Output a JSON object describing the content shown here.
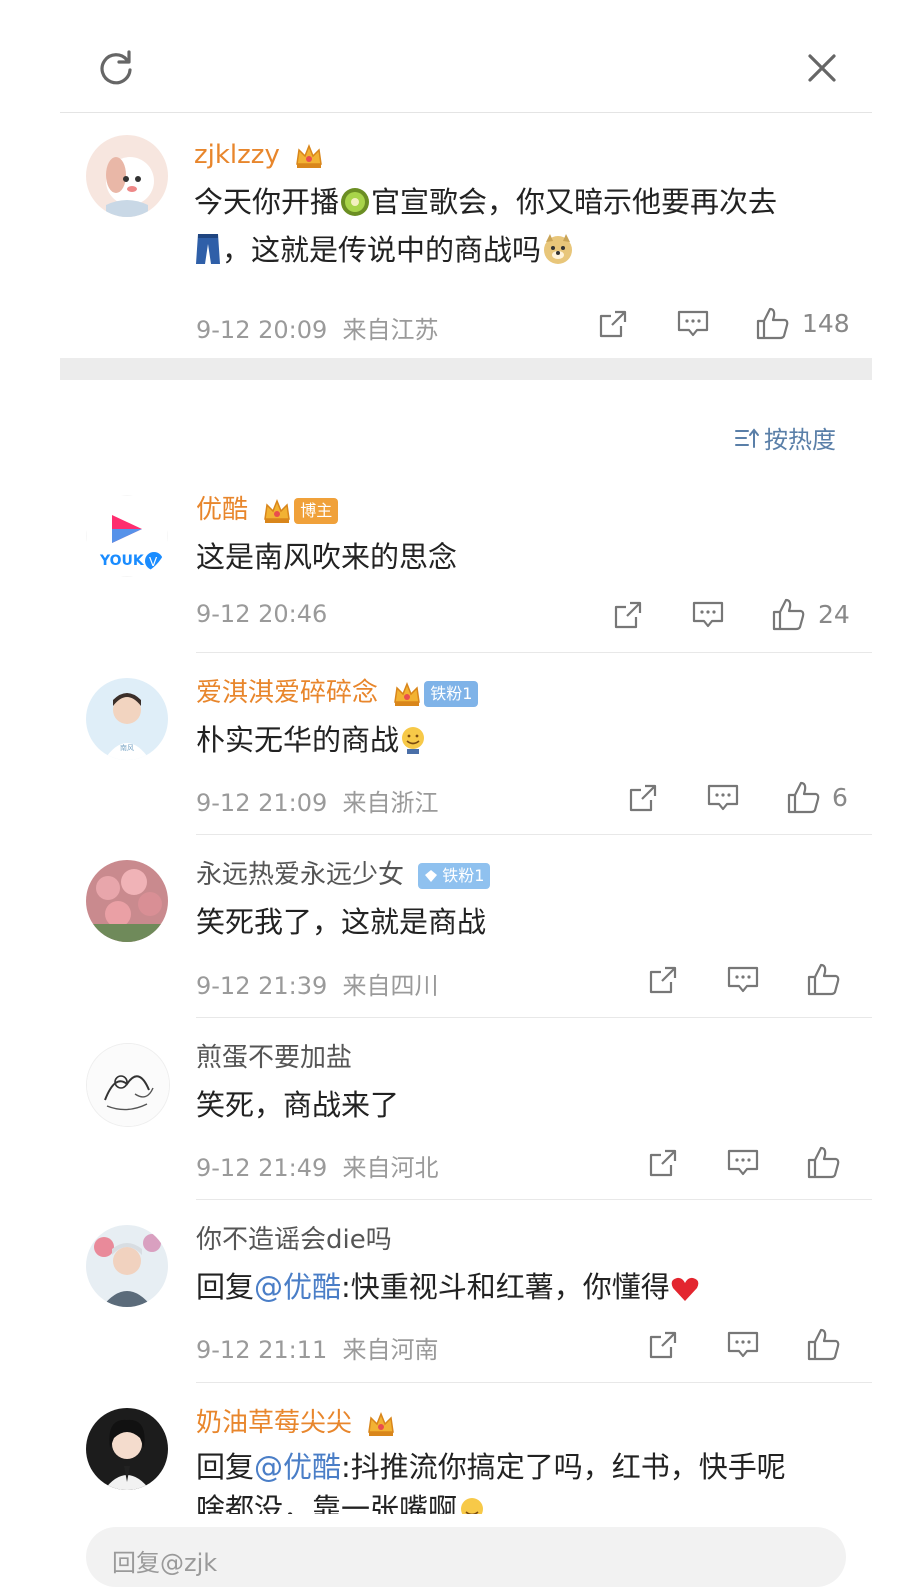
{
  "header": {
    "refresh_icon": "refresh-icon",
    "close_icon": "close-icon"
  },
  "main_post": {
    "username": "zjklzzy",
    "text_part1": "今天你开播",
    "text_part2": "官宣歌会，你又暗示他要再次去",
    "text_part3": "，这就是传说中的商战吗",
    "time": "9-12 20:09",
    "location": "来自江苏",
    "likes": "148"
  },
  "sort_label": "按热度",
  "comments": [
    {
      "username": "优酷",
      "badge_tag": "博主",
      "text": "这是南风吹来的思念",
      "time": "9-12 20:46",
      "location": "",
      "likes": "24"
    },
    {
      "username": "爱淇淇爱碎碎念",
      "badge_tag": "铁粉1",
      "text": "朴实无华的商战",
      "time": "9-12 21:09",
      "location": "来自浙江",
      "likes": "6"
    },
    {
      "username": "永远热爱永远少女",
      "badge_tag": "铁粉1",
      "text": "笑死我了，这就是商战",
      "time": "9-12 21:39",
      "location": "来自四川",
      "likes": ""
    },
    {
      "username": "煎蛋不要加盐",
      "badge_tag": "",
      "text": "笑死，商战来了",
      "time": "9-12 21:49",
      "location": "来自河北",
      "likes": ""
    },
    {
      "username": "你不造谣会die吗",
      "badge_tag": "",
      "reply_prefix": "回复",
      "mention": "@优酷",
      "text": ":快重视斗和红薯，你懂得",
      "time": "9-12 21:11",
      "location": "来自河南",
      "likes": ""
    },
    {
      "username": "奶油草莓尖尖",
      "badge_tag": "",
      "reply_prefix": "回复",
      "mention": "@优酷",
      "text": ":抖推流你搞定了吗，红书，快手呢",
      "text_line2": "啥都没，靠一张嘴啊",
      "time": "",
      "location": "",
      "likes": ""
    }
  ],
  "reply_input": {
    "placeholder": "回复@zjk"
  },
  "colors": {
    "accent_orange": "#e8862c",
    "mention_blue": "#4a7ec7",
    "sort_blue": "#5a7fa8"
  }
}
